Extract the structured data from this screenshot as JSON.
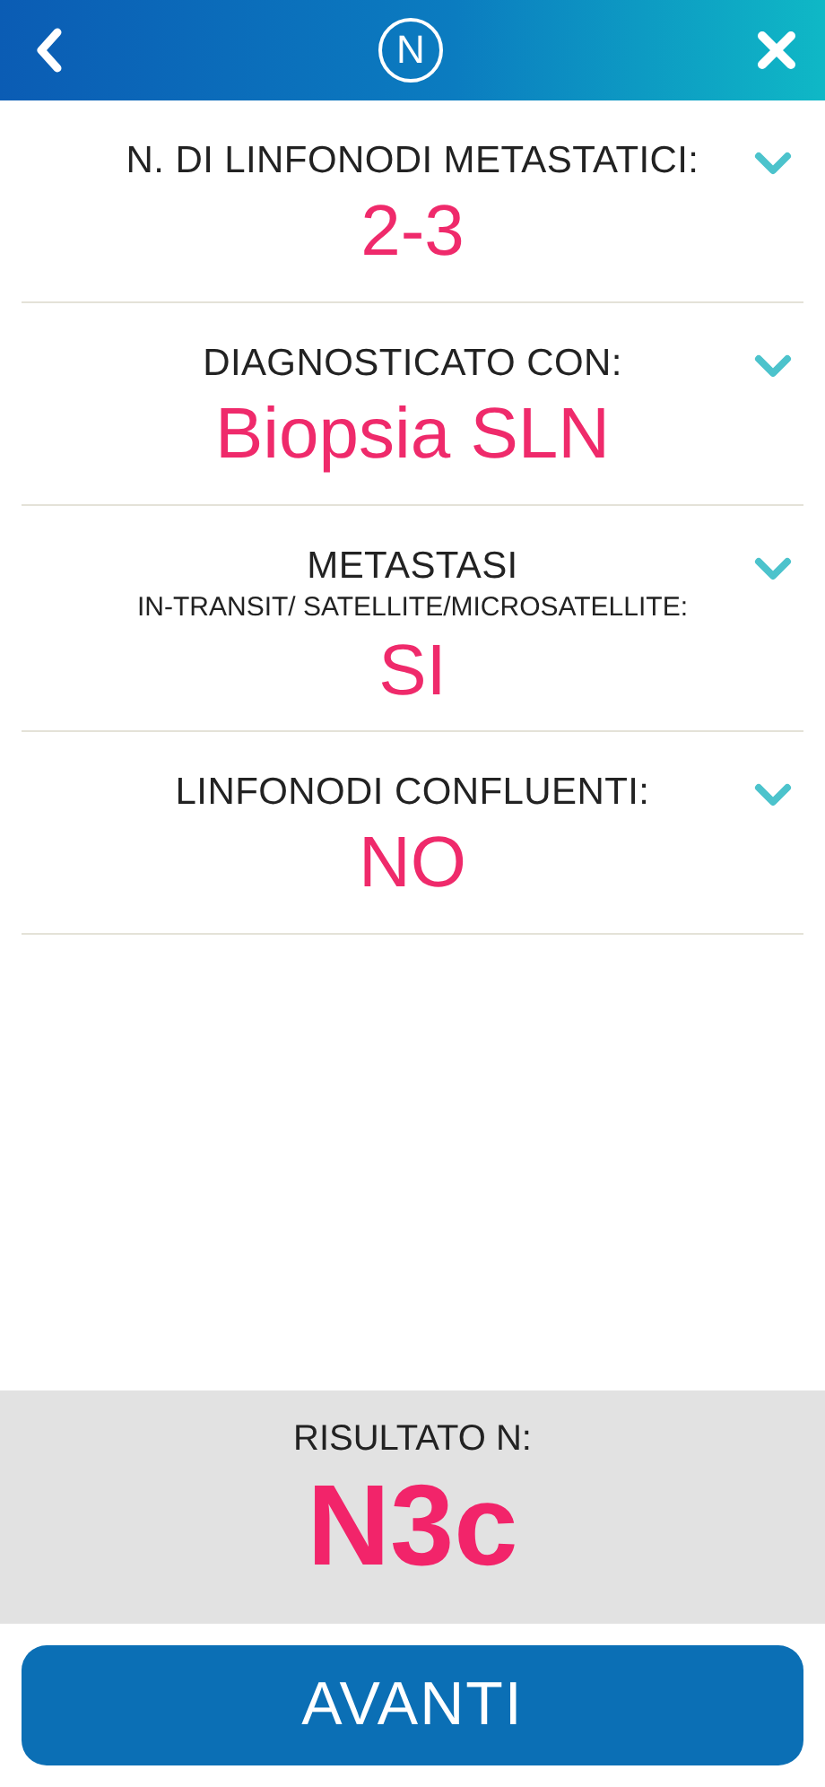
{
  "header": {
    "logo_letter": "N"
  },
  "fields": [
    {
      "label": "N. DI LINFONODI METASTATICI:",
      "value": "2-3"
    },
    {
      "label": "DIAGNOSTICATO CON:",
      "value": "Biopsia SLN"
    },
    {
      "label": "METASTASI",
      "sublabel": "IN-TRANSIT/ SATELLITE/MICROSATELLITE:",
      "value": "SI"
    },
    {
      "label": "LINFONODI CONFLUENTI:",
      "value": "NO"
    }
  ],
  "result": {
    "label": "RISULTATO N:",
    "value": "N3c"
  },
  "button": "AVANTI"
}
